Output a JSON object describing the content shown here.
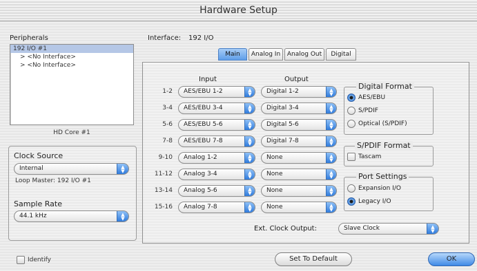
{
  "window": {
    "title": "Hardware Setup"
  },
  "peripherals": {
    "label": "Peripherals",
    "items": [
      "192 I/O #1",
      "> <No Interface>",
      "> <No Interface>"
    ],
    "footer": "HD Core #1"
  },
  "interface": {
    "label": "Interface:",
    "value": "192 I/O"
  },
  "tabs": [
    "Main",
    "Analog In",
    "Analog Out",
    "Digital"
  ],
  "clock": {
    "label": "Clock Source",
    "value": "Internal",
    "loop_master": "Loop Master: 192 I/O #1",
    "rate_label": "Sample Rate",
    "rate_value": "44.1 kHz"
  },
  "io": {
    "input_header": "Input",
    "output_header": "Output",
    "rows": [
      {
        "ch": "1-2",
        "input": "AES/EBU 1-2",
        "output": "Digital 1-2"
      },
      {
        "ch": "3-4",
        "input": "AES/EBU 3-4",
        "output": "Digital 3-4"
      },
      {
        "ch": "5-6",
        "input": "AES/EBU 5-6",
        "output": "Digital 5-6"
      },
      {
        "ch": "7-8",
        "input": "AES/EBU 7-8",
        "output": "Digital 7-8"
      },
      {
        "ch": "9-10",
        "input": "Analog 1-2",
        "output": "None"
      },
      {
        "ch": "11-12",
        "input": "Analog 3-4",
        "output": "None"
      },
      {
        "ch": "13-14",
        "input": "Analog 5-6",
        "output": "None"
      },
      {
        "ch": "15-16",
        "input": "Analog 7-8",
        "output": "None"
      }
    ]
  },
  "digital_format": {
    "title": "Digital Format",
    "options": [
      "AES/EBU",
      "S/PDIF",
      "Optical (S/PDIF)"
    ],
    "selected": 0
  },
  "spdif_format": {
    "title": "S/PDIF Format",
    "option": "Tascam"
  },
  "port_settings": {
    "title": "Port Settings",
    "options": [
      "Expansion I/O",
      "Legacy I/O"
    ],
    "selected": 1
  },
  "ext_clock": {
    "label": "Ext. Clock Output:",
    "value": "Slave Clock"
  },
  "footer": {
    "identify": "Identify",
    "default_label": "Set To Default",
    "ok_label": "OK"
  },
  "colors": {
    "accent": "#3f8ae6",
    "selection": "#b5c7e6"
  }
}
